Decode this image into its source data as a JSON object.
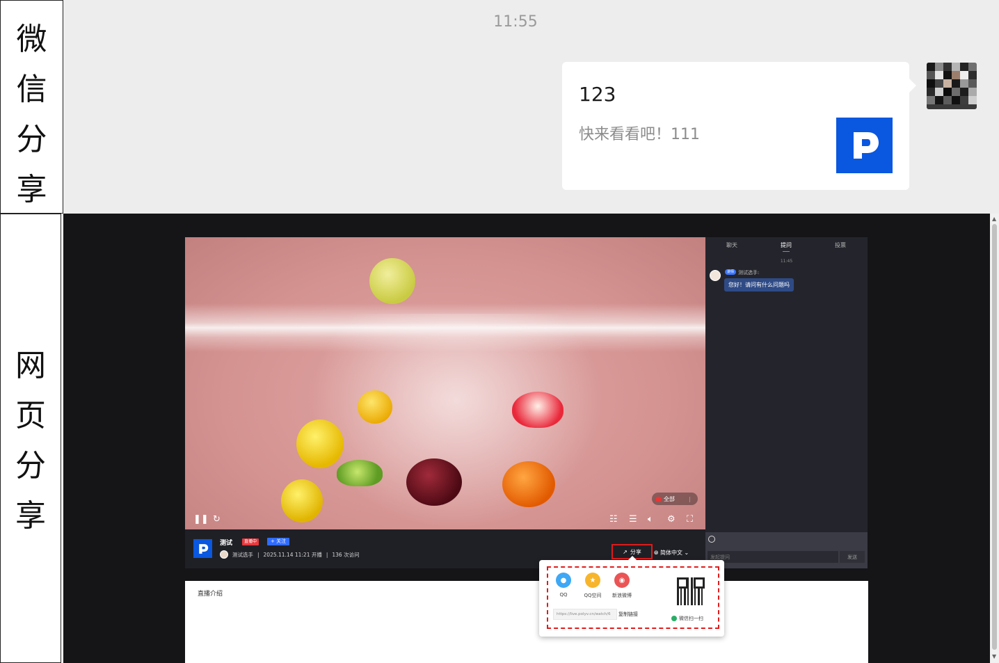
{
  "labels": {
    "wechat": [
      "微",
      "信",
      "分",
      "享"
    ],
    "web": [
      "网",
      "页",
      "分",
      "享"
    ]
  },
  "wechat_chat": {
    "time": "11:55",
    "card": {
      "title": "123",
      "description": "快来看看吧！111",
      "logo_icon": "polyv-logo-icon"
    }
  },
  "player": {
    "controls": {
      "play_pause_icon": "pause-icon",
      "refresh_icon": "refresh-icon",
      "barrage_label": "全部"
    },
    "info": {
      "title": "测试",
      "live_badge": "直播中",
      "follow_label": "+ 关注",
      "host": "测试选手",
      "start_time": "2025.11.14 11:21 开播",
      "visits": "136 次访问",
      "share_label": "分享",
      "language_label": "简体中文"
    }
  },
  "chat_panel": {
    "tabs": [
      "聊天",
      "提问",
      "投票"
    ],
    "time": "11:45",
    "message": {
      "role_badge": "讲师",
      "sender": "测试选手:",
      "text": "您好！请问有什么问题吗"
    },
    "input_placeholder": "发起提问",
    "send_label": "发送"
  },
  "description": {
    "title": "直播介绍"
  },
  "share_popup": {
    "items": [
      {
        "label": "QQ",
        "icon": "qq-icon",
        "color": "#3ea8f5"
      },
      {
        "label": "QQ空间",
        "icon": "qzone-icon",
        "color": "#f7b52c"
      },
      {
        "label": "新浪微博",
        "icon": "weibo-icon",
        "color": "#ea5455"
      }
    ],
    "link": "https://live.polyv.cn/watch/6",
    "copy_label": "复制链接",
    "wechat_scan_label": "微信扫一扫"
  },
  "colors": {
    "brand_blue": "#0a57e0",
    "highlight_red": "#e01b1b",
    "wechat_bg": "#ededed",
    "web_bg": "#151518"
  }
}
